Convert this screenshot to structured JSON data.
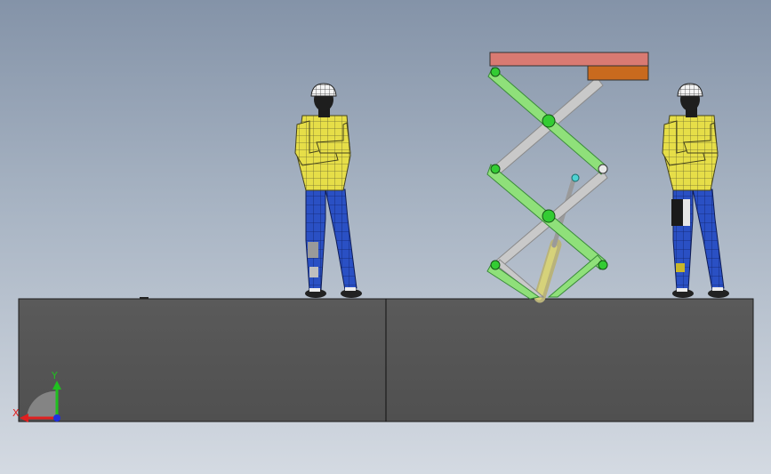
{
  "viewport": {
    "background_top": "#8493a8",
    "background_bottom": "#d4dae2"
  },
  "scene": {
    "floor_color": "#545454",
    "scissor_arm_green": "#8fe07a",
    "scissor_arm_gray": "#c9c9c9",
    "joint_green": "#33cc33",
    "platform_top_color": "#d97a72",
    "platform_block_color": "#c96a1e",
    "cylinder_color": "#c8c46a",
    "worker_shirt_color": "#e8e04a",
    "worker_pants_color": "#2a4fc0"
  },
  "triad": {
    "y_label": "Y",
    "x_label": "X",
    "x_color": "#e02020",
    "y_color": "#20c020",
    "z_color": "#2030e0"
  }
}
